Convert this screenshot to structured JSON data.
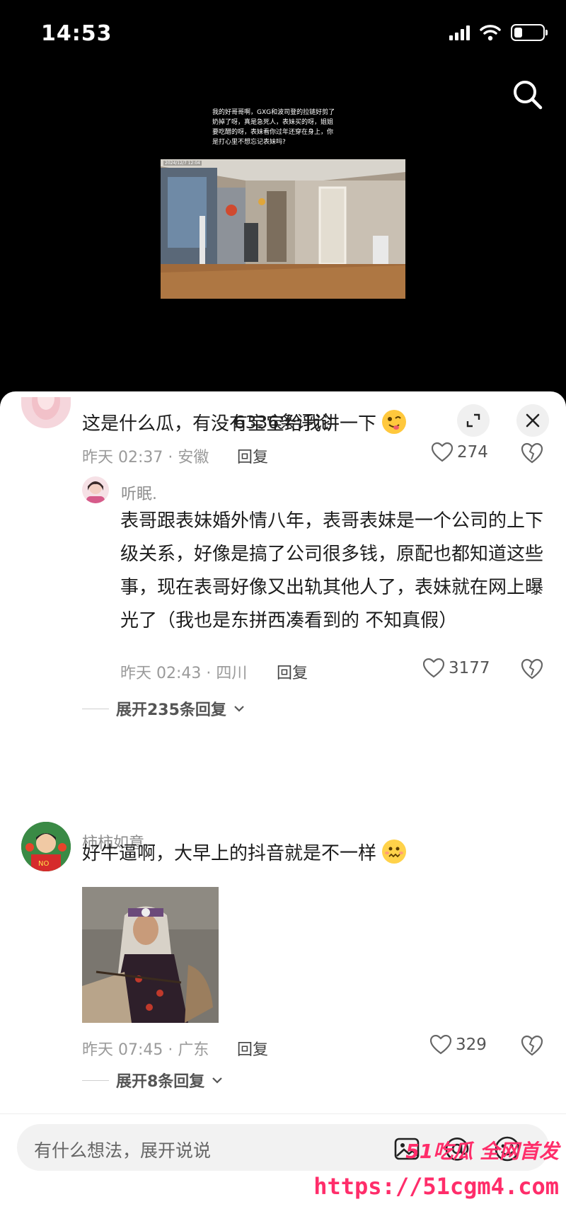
{
  "status": {
    "time": "14:53"
  },
  "video": {
    "caption": "我的好哥哥啊，GXG和波司登的拉链好剪了奶掉了呀，真是急死人，表妹买的呀，姐姐要吃醋的呀，表妹看你过年还穿在身上，你是打心里不想忘记表妹吗?",
    "timestamp": "2024/12/7 12:04"
  },
  "sheet": {
    "title": "6336条评论"
  },
  "comments": [
    {
      "text": "这是什么瓜，有没有宝宝给我讲一下",
      "time": "昨天 02:37 · 安徽",
      "reply": "回复",
      "likes": "274"
    },
    {
      "user": "听眠.",
      "text": "表哥跟表妹婚外情八年，表哥表妹是一个公司的上下级关系，好像是搞了公司很多钱，原配也都知道这些事，现在表哥好像又出轨其他人了，表妹就在网上曝光了（我也是东拼西凑看到的 不知真假）",
      "time": "昨天 02:43 · 四川",
      "reply": "回复",
      "likes": "3177",
      "expand": "展开235条回复"
    },
    {
      "user": "柿柿如意",
      "text": "好牛逼啊，大早上的抖音就是不一样",
      "time": "昨天 07:45 · 广东",
      "reply": "回复",
      "likes": "329",
      "expand": "展开8条回复"
    }
  ],
  "input": {
    "placeholder": "有什么想法，展开说说"
  },
  "watermark": {
    "brand": "51吃瓜 全网首发",
    "url": "https://51cgm4.com"
  },
  "icons": [
    "search-icon",
    "expand-icon",
    "close-icon",
    "heart-icon",
    "broken-heart-icon",
    "image-icon",
    "at-icon",
    "emoji-icon",
    "chevron-down-icon"
  ]
}
